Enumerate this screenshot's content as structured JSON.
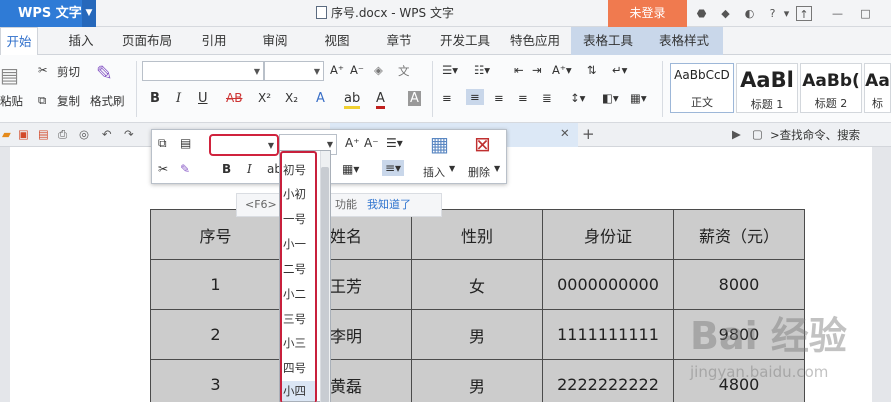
{
  "titlebar": {
    "app_name": "WPS 文字",
    "document_title": "序号.docx - WPS 文字",
    "login_label": "未登录"
  },
  "tabs": [
    "开始",
    "插入",
    "页面布局",
    "引用",
    "审阅",
    "视图",
    "章节",
    "开发工具",
    "特色应用",
    "表格工具",
    "表格样式"
  ],
  "ribbon": {
    "cut_label": "剪切",
    "paste_label": "粘贴",
    "copy_label": "复制",
    "format_painter_label": "格式刷",
    "styles": [
      {
        "preview": "AaBbCcD",
        "label": "正文"
      },
      {
        "preview": "AaBl",
        "label": "标题 1"
      },
      {
        "preview": "AaBb(",
        "label": "标题 2"
      },
      {
        "preview": "Aa",
        "label": "标"
      }
    ]
  },
  "quick": {
    "search_text": ">查找命令、搜索"
  },
  "mini_toolbar": {
    "insert_label": "插入",
    "delete_label": "删除"
  },
  "hint": {
    "text": "<F6>",
    "suffix": "功能",
    "ok_label": "我知道了"
  },
  "font_size_options": [
    "初号",
    "小初",
    "一号",
    "小一",
    "二号",
    "小二",
    "三号",
    "小三",
    "四号",
    "小四"
  ],
  "table": {
    "headers": [
      "序号",
      "姓名",
      "性别",
      "身份证",
      "薪资（元）"
    ],
    "rows": [
      [
        "1",
        "王芳",
        "女",
        "0000000000",
        "8000"
      ],
      [
        "2",
        "李明",
        "男",
        "1111111111",
        "9800"
      ],
      [
        "3",
        "黄磊",
        "男",
        "2222222222",
        "4800"
      ]
    ]
  },
  "watermark": {
    "brand": "Bai 经验",
    "url": "jingyan.baidu.com"
  }
}
